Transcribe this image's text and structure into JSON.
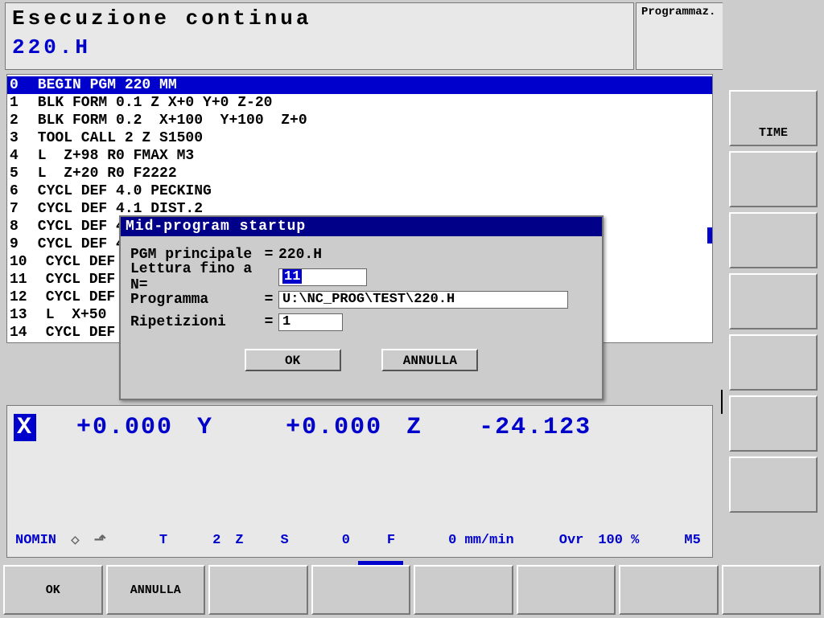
{
  "header": {
    "title": "Esecuzione continua",
    "file": "220.H",
    "right_mode": "Programmaz."
  },
  "code": {
    "lines": [
      {
        "n": "0",
        "text": "BEGIN PGM 220 MM",
        "hl": true
      },
      {
        "n": "1",
        "text": "BLK FORM 0.1 Z X+0 Y+0 Z-20"
      },
      {
        "n": "2",
        "text": "BLK FORM 0.2  X+100  Y+100  Z+0"
      },
      {
        "n": "3",
        "text": "TOOL CALL 2 Z S1500"
      },
      {
        "n": "4",
        "text": "L  Z+98 R0 FMAX M3"
      },
      {
        "n": "5",
        "text": "L  Z+20 R0 F2222"
      },
      {
        "n": "6",
        "text": "CYCL DEF 4.0 PECKING"
      },
      {
        "n": "7",
        "text": "CYCL DEF 4.1 DIST.2"
      },
      {
        "n": "8",
        "text": "CYCL DEF 4"
      },
      {
        "n": "9",
        "text": "CYCL DEF 4"
      },
      {
        "n": "10",
        "text": "CYCL DEF 4"
      },
      {
        "n": "11",
        "text": "CYCL DEF 4"
      },
      {
        "n": "12",
        "text": "CYCL DEF 4"
      },
      {
        "n": "13",
        "text": "L  X+50  Y"
      },
      {
        "n": "14",
        "text": "CYCL DEF 2"
      }
    ]
  },
  "dialog": {
    "title": "Mid-program startup",
    "row_pgm_label": "PGM principale",
    "row_pgm_value": "220.H",
    "row_n_label": "Lettura fino a N=",
    "row_n_value": "11",
    "row_prog_label": "Programma",
    "row_prog_value": "U:\\NC_PROG\\TEST\\220.H",
    "row_rep_label": "Ripetizioni",
    "row_rep_value": "1",
    "ok": "OK",
    "cancel": "ANNULLA"
  },
  "status": {
    "x_label": "X",
    "x_val": "+0.000",
    "y_label": "Y",
    "y_val": "+0.000",
    "z_label": "Z",
    "z_val": "-24.123",
    "nomin": "NOMIN",
    "t_label": "T",
    "t_val": "2",
    "zaxis_label": "Z",
    "s_label": "S",
    "s_val": "0",
    "f_label": "F",
    "f_val": "0 mm/min",
    "ovr_label": "Ovr",
    "ovr_val": "100 %",
    "m_val": "M5"
  },
  "softkeys": {
    "sk1": "OK",
    "sk2": "ANNULLA",
    "sk3": "",
    "sk4": "",
    "sk5": "",
    "sk6": "",
    "sk7": "",
    "sk8": ""
  },
  "right_buttons": {
    "b1": "TIME",
    "b2": "",
    "b3": "",
    "b4": "",
    "b5": "",
    "b6": "",
    "b7": ""
  }
}
